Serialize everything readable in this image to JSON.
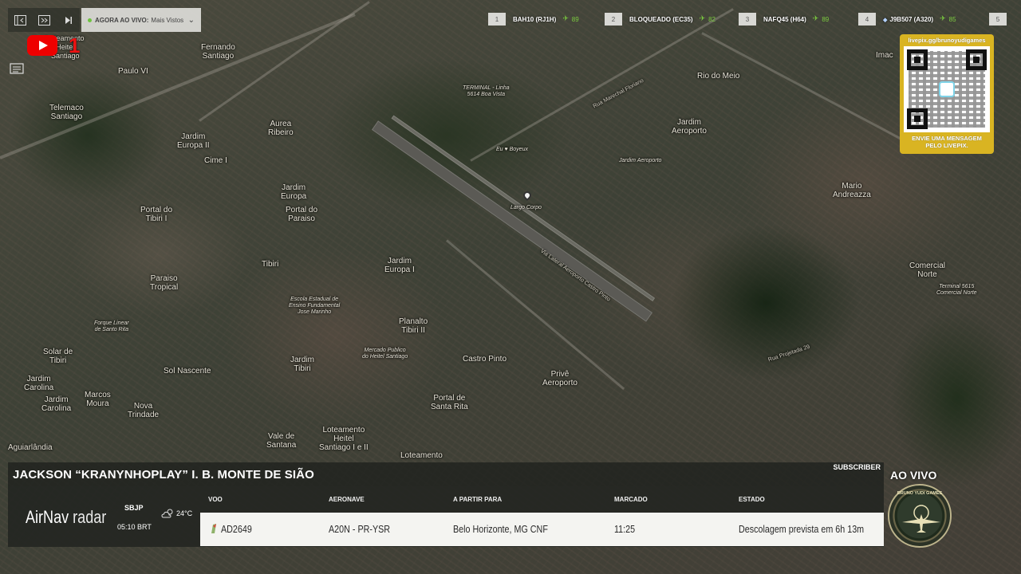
{
  "topbar": {
    "now_live_label": "AGORA AO VIVO:",
    "now_live_value": "Mais Vistos"
  },
  "youtube": {
    "count": "1"
  },
  "ranking": [
    {
      "position": "1",
      "name": "BAH10 (RJ1H)",
      "score": "89",
      "flag": ""
    },
    {
      "position": "2",
      "name": "BLOQUEADO (EC35)",
      "score": "82",
      "flag": ""
    },
    {
      "position": "3",
      "name": "NAFQ45 (H64)",
      "score": "89",
      "flag": ""
    },
    {
      "position": "4",
      "name": "J9B507 (A320)",
      "score": "85",
      "flag": "◆"
    },
    {
      "position": "5",
      "name": "",
      "score": "",
      "flag": ""
    }
  ],
  "qr": {
    "url": "livepix.gg/brunoyudigames",
    "message_line1": "ENVIE UMA MENSAGEM",
    "message_line2": "PELO LIVEPIX."
  },
  "map_labels": {
    "fernando": "Fernando",
    "fernando2": "Santiago",
    "loteamento_tl1": "Loteamento",
    "loteamento_tl2": "Heitel",
    "loteamento_tl3": "Santiago",
    "paulo_vi": "Paulo VI",
    "telemaco1": "Telemaco",
    "telemaco2": "Santiago",
    "aurea1": "Aurea",
    "aurea2": "Ribeiro",
    "jardim_europa_ii_1": "Jardim",
    "jardim_europa_ii_2": "Europa II",
    "cime": "Cime I",
    "jardim_europa1": "Jardim",
    "jardim_europa2": "Europa",
    "portal_tibiri1": "Portal do",
    "portal_tibiri2": "Tibiri I",
    "portal_paraiso1": "Portal do",
    "portal_paraiso2": "Paraiso",
    "tibiri": "Tibiri",
    "paraiso1": "Paraiso",
    "paraiso2": "Tropical",
    "forque1": "Forque Linear",
    "forque2": "de Santo Rita",
    "escola1": "Escola Estadual de",
    "escola2": "Ensino Fundamental",
    "escola3": "Jose Marinho",
    "jardim_europa_i_1": "Jardim",
    "jardim_europa_i_2": "Europa I",
    "planalto1": "Planalto",
    "planalto2": "Tibiri II",
    "mercado1": "Mercado Publico",
    "mercado2": "do Heitel Santiago",
    "solar1": "Solar de",
    "solar2": "Tibiri",
    "sol_nascente": "Sol Nascente",
    "jardim_tibiri1": "Jardim",
    "jardim_tibiri2": "Tibiri",
    "castro_pinto": "Castro Pinto",
    "jardim_carolina1": "Jardim",
    "jardim_carolina2": "Carolina",
    "marcos1": "Marcos",
    "marcos2": "Moura",
    "jardim_carolina_b1": "Jardim",
    "jardim_carolina_b2": "Carolina",
    "nova1": "Nova",
    "nova2": "Trindade",
    "portal_santa1": "Portal de",
    "portal_santa2": "Santa Rita",
    "prive1": "Privê",
    "prive2": "Aeroporto",
    "vale1": "Vale de",
    "vale2": "Santana",
    "lot_heitel1": "Loteamento",
    "lot_heitel2": "Heitel",
    "lot_heitel3": "Santiago I e II",
    "aguiarlandia": "Aguiarlândia",
    "loteamento_bottom": "Loteamento",
    "terminal1": "TERMINAL - Linha",
    "terminal2": "5614 Boa Vista",
    "eu_boyeux": "Eu ♥ Boyeux",
    "largo_corpo": "Largo Corpo",
    "rio_do_meio": "Rio do Meio",
    "jardim_aeroporto1": "Jardim",
    "jardim_aeroporto2": "Aeroporto",
    "jardim_aeroporto_small": "Jardim Aeroporto",
    "mario1": "Mario",
    "mario2": "Andreazza",
    "comercial1": "Comercial",
    "comercial2": "Norte",
    "terminal_cn1": "Terminal 5615",
    "terminal_cn2": "Comercial Norte",
    "imac": "Imac",
    "rua_projetada": "Rua Projetada 29",
    "via_lateral": "Via Lateral Aeroporto Castro Pinto",
    "rua_marechal": "Rua Marechal Floriano"
  },
  "sponsor": {
    "name": "JACKSON “KRANYNHOPLAY” I. B. MONTE DE SIÃO",
    "subscriber_label": "SUBSCRIBER"
  },
  "airnav": {
    "brand": "AirNav",
    "brand_suffix": "radar"
  },
  "airport": {
    "code": "SBJP",
    "time": "05:10 BRT",
    "temperature": "24°C"
  },
  "flight_table": {
    "headers": {
      "flight": "VOO",
      "aircraft": "AERONAVE",
      "route": "A PARTIR PARA",
      "scheduled": "MARCADO",
      "status": "ESTADO"
    },
    "row": {
      "flight": "AD2649",
      "aircraft": "A20N - PR-YSR",
      "route": "Belo Horizonte, MG CNF",
      "scheduled": "11:25",
      "status": "Descolagem prevista em 6h 13m"
    }
  },
  "live": {
    "label": "AO VIVO"
  },
  "channel_badge": {
    "top_text": "BRUNO YUDI GAMES",
    "bottom_text": ""
  },
  "colors": {
    "score_green": "#7bcb3f",
    "youtube_red": "#ee0000",
    "qr_gold": "#d9b422"
  }
}
